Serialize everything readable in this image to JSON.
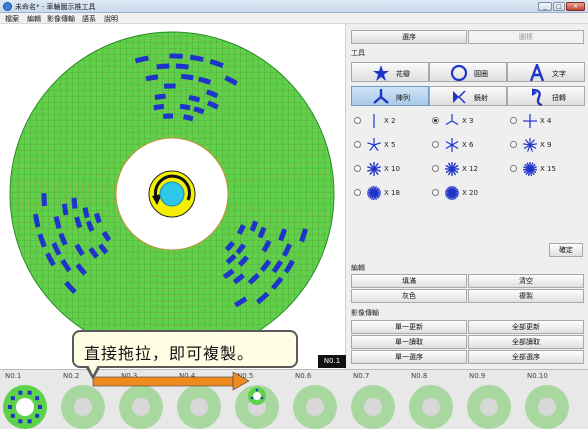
{
  "window": {
    "title": "未命名* - 車輪圖示推工具",
    "min": "_",
    "max": "□",
    "close": "✕"
  },
  "menu": [
    "檔案",
    "編輯",
    "影像傳輸",
    "語系",
    "說明"
  ],
  "tabs": {
    "edit": "選序",
    "pattern": "圖樣"
  },
  "tools": {
    "section_label": "工具",
    "buttons": [
      {
        "label": "花瓣",
        "icon": "star-burst-icon"
      },
      {
        "label": "圓圈",
        "icon": "circle-icon"
      },
      {
        "label": "文字",
        "icon": "letter-a-icon"
      },
      {
        "label": "陣列",
        "icon": "tri-spoke-icon"
      },
      {
        "label": "鏡射",
        "icon": "mirror-icon"
      },
      {
        "label": "扭轉",
        "icon": "twist-icon"
      }
    ],
    "array_options": [
      {
        "label": "X 2",
        "selected": false
      },
      {
        "label": "X 3",
        "selected": true
      },
      {
        "label": "X 4",
        "selected": false
      },
      {
        "label": "X 5",
        "selected": false
      },
      {
        "label": "X 6",
        "selected": false
      },
      {
        "label": "X 9",
        "selected": false
      },
      {
        "label": "X 10",
        "selected": false
      },
      {
        "label": "X 12",
        "selected": false
      },
      {
        "label": "X 15",
        "selected": false
      },
      {
        "label": "X 18",
        "selected": false
      },
      {
        "label": "X 20",
        "selected": false
      }
    ],
    "confirm": "確定"
  },
  "edit": {
    "section_label": "編輯",
    "buttons": [
      "填滿",
      "清空",
      "灰色",
      "複製"
    ]
  },
  "transfer": {
    "section_label": "影像傳輸",
    "buttons": [
      "單一更新",
      "全部更新",
      "單一讀取",
      "全部讀取",
      "單一選序",
      "全部選序"
    ]
  },
  "tooltip": {
    "text": "直接拖拉，即可複製。",
    "badge": "N0.1"
  },
  "slots": [
    "N0.1",
    "N0.2",
    "N0.3",
    "N0.4",
    "N0.5",
    "N0.6",
    "N0.7",
    "N0.8",
    "N0.9",
    "N0.10"
  ],
  "colors": {
    "wheel_green": "#5ed24a",
    "pattern_blue": "#1f35c9",
    "hub_yellow": "#f4f000",
    "hub_cyan": "#2fc7e8",
    "arrow_orange": "#ef8a1f"
  }
}
